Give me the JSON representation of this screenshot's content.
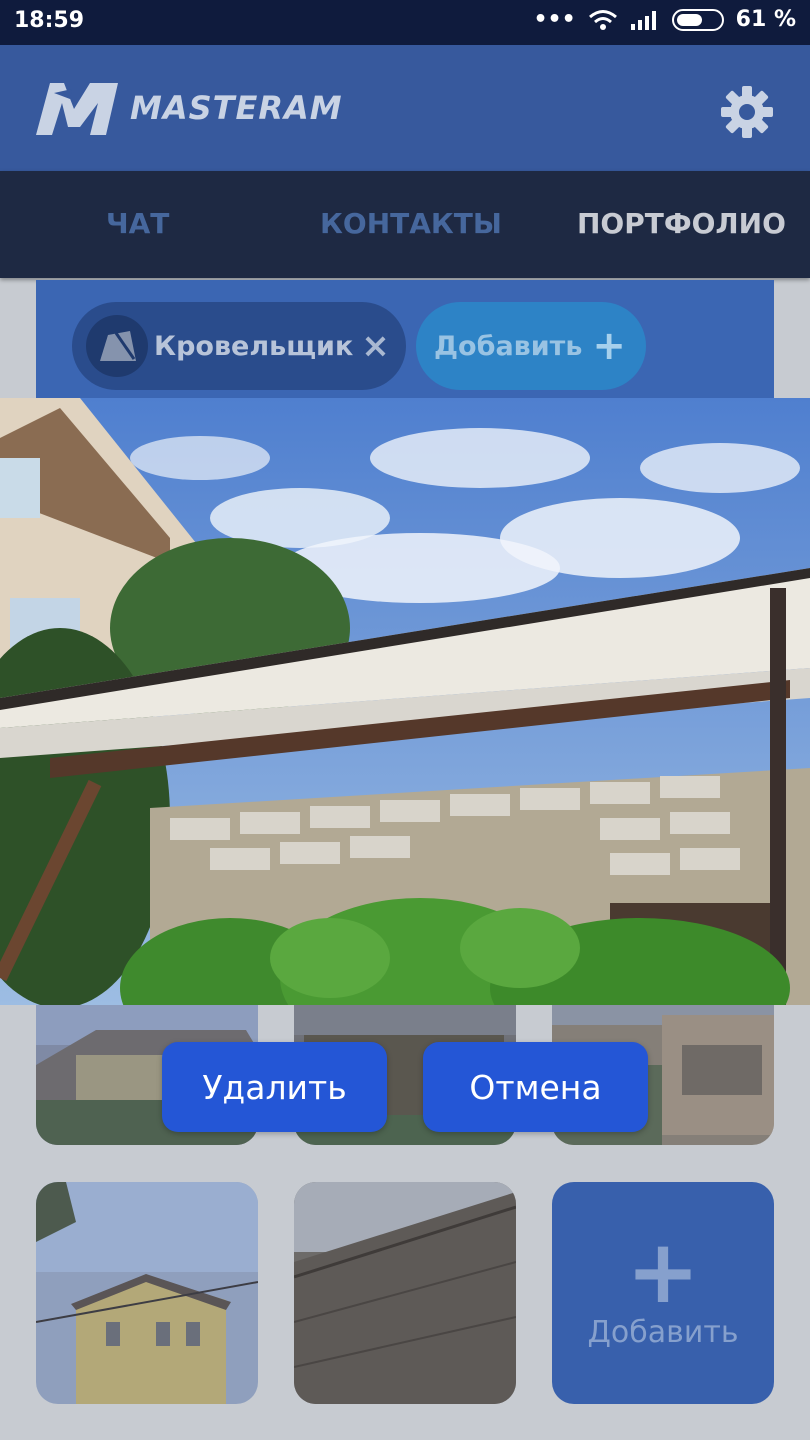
{
  "status_bar": {
    "time": "18:59",
    "signal_dots": "•••",
    "battery_percent": "61 %",
    "battery_level": 0.61
  },
  "app_bar": {
    "brand": "MASTERAM",
    "settings_icon": "gear-icon"
  },
  "tabs": [
    {
      "label": "ЧАТ",
      "active": false
    },
    {
      "label": "КОНТАКТЫ",
      "active": false
    },
    {
      "label": "ПОРТФОЛИО",
      "active": true
    }
  ],
  "chips": {
    "profession": "Кровельщик",
    "remove_icon": "×",
    "add_label": "Добавить",
    "add_icon": "+"
  },
  "gallery": {
    "add_tile_label": "Добавить",
    "add_tile_icon": "+"
  },
  "dialog": {
    "delete_label": "Удалить",
    "cancel_label": "Отмена"
  },
  "colors": {
    "status_bar": "#0f1b3d",
    "app_bar": "#37599d",
    "tabs_bg": "#1e2943",
    "button": "#2456d6",
    "overlay_bg": "#c7cbd1"
  }
}
